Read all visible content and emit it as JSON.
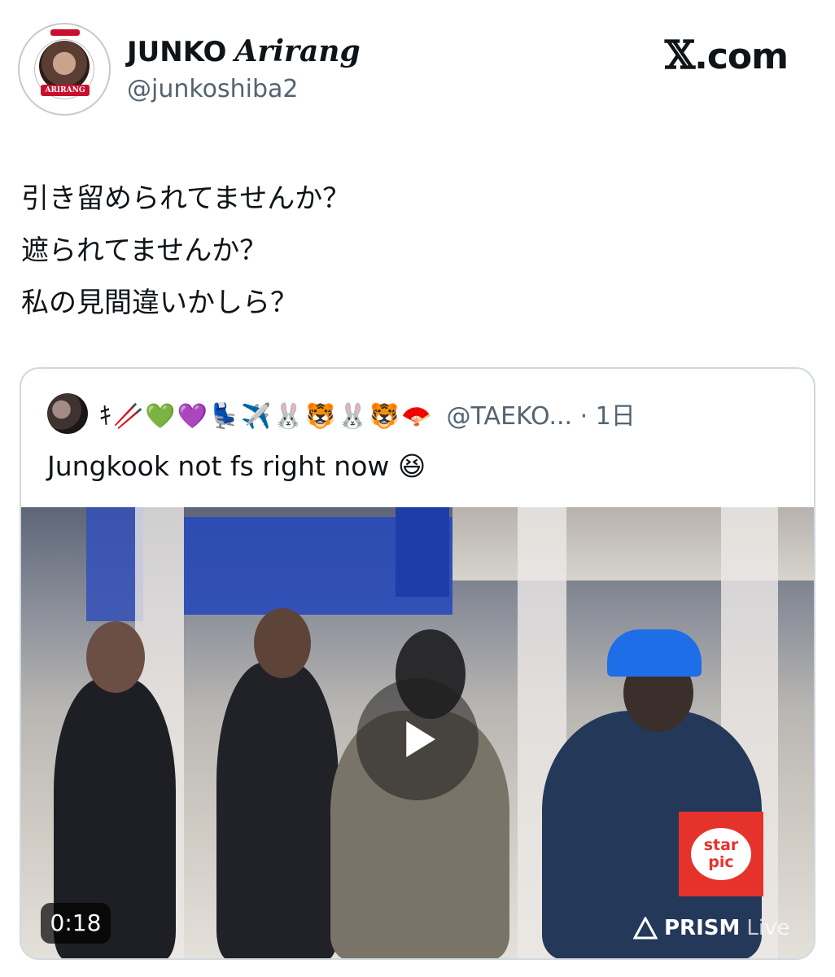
{
  "author": {
    "name": "JUNKO",
    "name_script": "Arirang",
    "handle": "@junkoshiba2",
    "avatar_band": "ARIRANG"
  },
  "site": {
    "label_x": "𝕏",
    "label_rest": ".com"
  },
  "tweet": {
    "lines": [
      "引き留められてませんか？",
      "遮られてませんか？",
      "私の見間違いかしら？"
    ]
  },
  "quote": {
    "display_name_emojis": "ｷ🥢💚💜💺✈️🐰🐯🐰🐯🪭",
    "handle_time": "@TAEKO... · 1日",
    "text": "Jungkook not fs right now 😆",
    "video": {
      "duration": "0:18",
      "watermark_top": "star",
      "watermark_bottom": "pic",
      "brand": "PRISM",
      "brand_suffix": "Live",
      "icon": "play-icon"
    }
  },
  "colors": {
    "text": "#0f1419",
    "secondary": "#536471",
    "border": "#cfd9de",
    "starpic": "#e5332b"
  }
}
